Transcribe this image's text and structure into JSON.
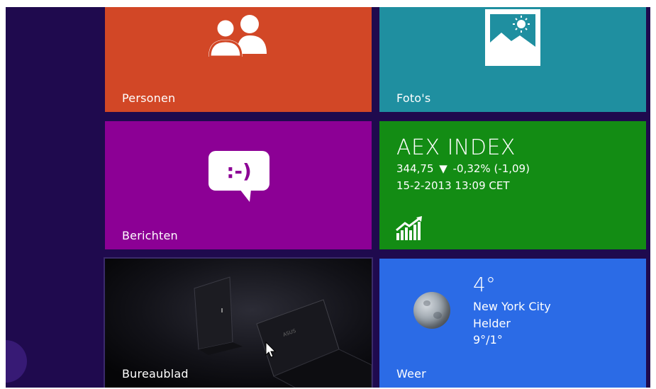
{
  "tiles": {
    "personen": {
      "label": "Personen",
      "color": "#d24726",
      "icon": "people-icon"
    },
    "fotos": {
      "label": "Foto's",
      "color": "#1f8fa0",
      "icon": "photo-icon"
    },
    "berichten": {
      "label": "Berichten",
      "color": "#8c0095",
      "icon": "chat-smiley-icon",
      "icon_text": ":-)"
    },
    "finance": {
      "color": "#138c14",
      "title": "AEX INDEX",
      "value": "344,75",
      "arrow": "▼",
      "change": "-0,32% (-1,09)",
      "date": "15-2-2013 13:09 CET",
      "icon": "finance-chart-icon"
    },
    "desktop": {
      "label": "Bureaublad",
      "icon": "laptop-wallpaper"
    },
    "weer": {
      "color": "#2b6be6",
      "label": "Weer",
      "temperature": "4°",
      "city": "New York City",
      "condition": "Helder",
      "range": "9°/1°",
      "icon": "moon-icon"
    }
  },
  "background_color": "#1f0a4e"
}
